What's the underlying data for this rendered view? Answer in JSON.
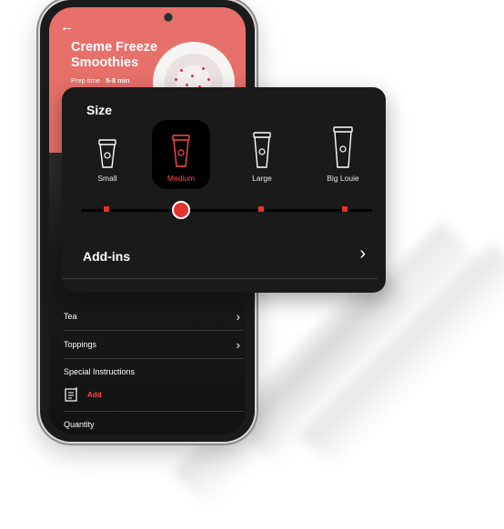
{
  "phone": {
    "back_icon": "back-arrow-icon",
    "title": "Creme Freeze Smoothies",
    "prep_label": "Prep time",
    "prep_value": "5-8 min",
    "list": [
      {
        "label": "Tea"
      },
      {
        "label": "Toppings"
      }
    ],
    "special_instructions": "Special Instructions",
    "add_label": "Add",
    "quantity_label": "Quantity",
    "colors": {
      "hero": "#e8706a",
      "accent": "#ff4a4a"
    }
  },
  "card": {
    "title": "Size",
    "sizes": [
      {
        "label": "Small",
        "icon": "cup-small-icon",
        "selected": false
      },
      {
        "label": "Medium",
        "icon": "cup-medium-icon",
        "selected": true
      },
      {
        "label": "Large",
        "icon": "cup-large-icon",
        "selected": false
      },
      {
        "label": "Big Louie",
        "icon": "cup-big-icon",
        "selected": false
      }
    ],
    "slider_selected_index": 1,
    "addins_label": "Add-ins",
    "accent": "#e5322e"
  }
}
